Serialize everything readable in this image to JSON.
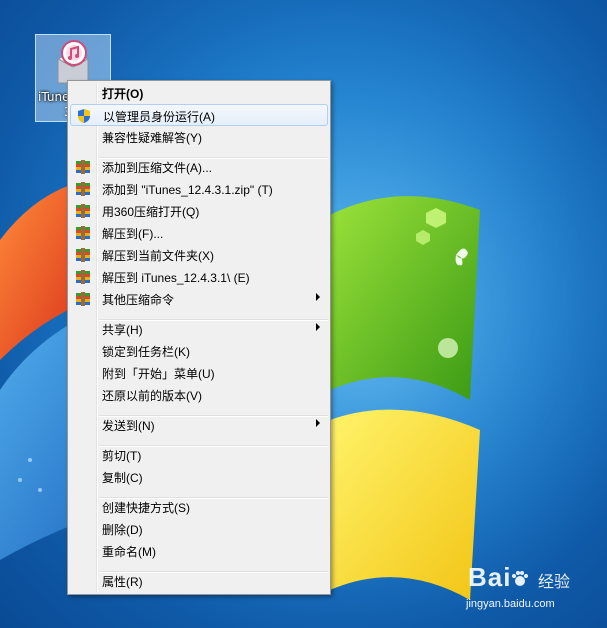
{
  "desktop": {
    "file": {
      "name_line1": "iTune",
      "name_line2": "3"
    }
  },
  "menu": {
    "items": [
      {
        "label": "打开(O)",
        "bold": true,
        "icon": ""
      },
      {
        "label": "以管理员身份运行(A)",
        "icon": "uac-shield-icon",
        "highlighted": true
      },
      {
        "label": "兼容性疑难解答(Y)",
        "icon": ""
      },
      {
        "label": "添加到压缩文件(A)...",
        "icon": "archive-icon"
      },
      {
        "label": "添加到 \"iTunes_12.4.3.1.zip\" (T)",
        "icon": "archive-icon"
      },
      {
        "label": "用360压缩打开(Q)",
        "icon": "archive-icon"
      },
      {
        "label": "解压到(F)...",
        "icon": "archive-icon"
      },
      {
        "label": "解压到当前文件夹(X)",
        "icon": "archive-icon"
      },
      {
        "label": "解压到 iTunes_12.4.3.1\\ (E)",
        "icon": "archive-icon"
      },
      {
        "label": "其他压缩命令",
        "icon": "archive-icon",
        "submenu": true
      },
      {
        "label": "共享(H)",
        "submenu": true
      },
      {
        "label": "锁定到任务栏(K)"
      },
      {
        "label": "附到「开始」菜单(U)"
      },
      {
        "label": "还原以前的版本(V)"
      },
      {
        "label": "发送到(N)",
        "submenu": true
      },
      {
        "label": "剪切(T)"
      },
      {
        "label": "复制(C)"
      },
      {
        "label": "创建快捷方式(S)"
      },
      {
        "label": "删除(D)"
      },
      {
        "label": "重命名(M)"
      },
      {
        "label": "属性(R)"
      }
    ]
  },
  "watermark": {
    "logo": "Bai",
    "logo_suffix": "du",
    "text": "经验",
    "url": "jingyan.baidu.com"
  },
  "colors": {
    "desktop": "#1f7fcd",
    "menu_bg": "#f0f0f0",
    "highlight_border": "#aecff7"
  }
}
